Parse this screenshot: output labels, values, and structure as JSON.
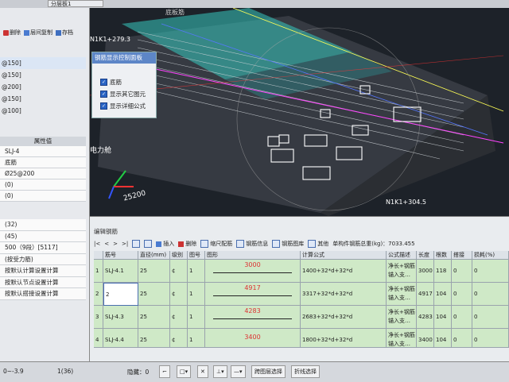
{
  "top": {
    "layer_select": "分层板1"
  },
  "left": {
    "toolbar": {
      "delete": "删除",
      "layer_copy": "层间复制",
      "save": "存档"
    },
    "spec_items": [
      "@150]",
      "@150]",
      "@200]",
      "@150]",
      "@100]"
    ],
    "property_header": "属性值",
    "properties": [
      "SLJ-4",
      "底筋",
      "Ø25@200",
      "(0)",
      "(0)"
    ],
    "properties2": [
      "(32)",
      "(45)",
      "500（9段）[5117]",
      "(按受力筋)",
      "按默认计算设置计算",
      "按默认节点设置计算",
      "按默认搭接设置计算"
    ]
  },
  "viewport": {
    "labels": {
      "top_a": "N1K1+279.3",
      "top_b": "底板筋",
      "room": "电力舱",
      "right": "N1K1+304.5",
      "axis": "25200"
    }
  },
  "control_panel": {
    "title": "钢筋显示控制面板",
    "options": [
      "底筋",
      "显示其它图元",
      "显示详细公式"
    ]
  },
  "editor": {
    "title": "编辑钢筋",
    "toolbar": {
      "insert": "插入",
      "delete": "删除",
      "scale": "缩尺配筋",
      "info": "钢筋信息",
      "library": "钢筋图库",
      "other": "其他",
      "total_weight": "单构件钢筋总重(kg)：7033.455"
    },
    "columns": [
      "筋号",
      "直径(mm)",
      "级别",
      "图号",
      "图形",
      "计算公式",
      "公式描述",
      "长度",
      "根数",
      "搭接",
      "损耗(%)"
    ],
    "rows": [
      {
        "idx": "1",
        "name": "SLJ-4.1",
        "dia": "25",
        "grade": "¢",
        "fig": "1",
        "shape": "3000",
        "formula": "1400+32*d+32*d",
        "desc": "净长+钢筋锚入支…",
        "len": "3000",
        "count": "118",
        "lap": "0",
        "loss": "0"
      },
      {
        "idx": "2",
        "name": "2",
        "dia": "25",
        "grade": "¢",
        "fig": "1",
        "shape": "4917",
        "formula": "3317+32*d+32*d",
        "desc": "净长+钢筋锚入支…",
        "len": "4917",
        "count": "104",
        "lap": "0",
        "loss": "0"
      },
      {
        "idx": "3",
        "name": "SLJ-4.3",
        "dia": "25",
        "grade": "¢",
        "fig": "1",
        "shape": "4283",
        "formula": "2683+32*d+32*d",
        "desc": "净长+钢筋锚入支…",
        "len": "4283",
        "count": "104",
        "lap": "0",
        "loss": "0"
      },
      {
        "idx": "4",
        "name": "SLJ-4.4",
        "dia": "25",
        "grade": "¢",
        "fig": "1",
        "shape": "3400",
        "formula": "1800+32*d+32*d",
        "desc": "净长+钢筋锚入支…",
        "len": "3400",
        "count": "104",
        "lap": "0",
        "loss": "0"
      }
    ]
  },
  "status": {
    "coords": "0~-3.9",
    "count": "1(36)",
    "hidden": "隐藏：0",
    "cross_layer": "跨图层选择",
    "polyline": "折线选择"
  },
  "colors": {
    "accent_blue": "#5d86c7",
    "row_green": "#cfe9c7",
    "shape_red": "#d33333",
    "cyan_band": "#37c8c0"
  }
}
